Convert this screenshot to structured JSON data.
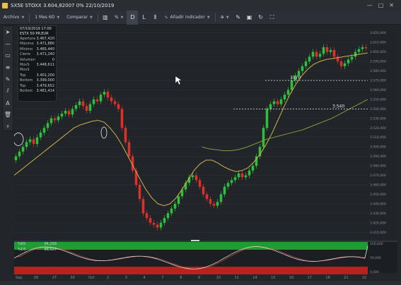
{
  "window": {
    "title": "SX5E STOXX 3.604,82007 0% 22/10/2019",
    "controls": [
      "—",
      "□",
      "✕"
    ]
  },
  "toolbar": {
    "archive_label": "Archivo",
    "period_label": "1 Mes 6D",
    "compare_label": "Comparar",
    "percent_label": "%",
    "d_label": "D",
    "l_label": "L",
    "indicator_label": "Añadir indicador"
  },
  "left_tools": [
    "cursor-icon",
    "crosshair-icon",
    "rectangle-icon",
    "fibonacci-icon",
    "pencil-icon",
    "channel-icon",
    "text-icon",
    "trash-icon",
    "magic-icon"
  ],
  "data_table": {
    "timestamp": "07/10/2019 17:00",
    "instrument": "ESTX 50 PR.EUR",
    "rows": [
      {
        "label": "Apertura",
        "value": "3.467,420"
      },
      {
        "label": "Máximo",
        "value": "3.471,880"
      },
      {
        "label": "Mínimo",
        "value": "3.465,440"
      },
      {
        "label": "Cierre",
        "value": "3.471,240"
      },
      {
        "label": "Volumen",
        "value": "0"
      },
      {
        "label": "MovS",
        "value": "3.448,611"
      },
      {
        "label": "MovS",
        "value": ""
      },
      {
        "label": "Top",
        "value": "3.401,200"
      },
      {
        "label": "Bottom",
        "value": "3.399,000"
      },
      {
        "label": "Top",
        "value": "3.479,652"
      },
      {
        "label": "Bottom",
        "value": "3.481,414"
      }
    ]
  },
  "indicator_legend": [
    {
      "label": "%KS",
      "value": "94,209"
    },
    {
      "label": "%DS",
      "value": "88,527"
    }
  ],
  "annotations": {
    "level_3570": "3570",
    "level_3540": "3.540"
  },
  "colors": {
    "up": "#2fbf3a",
    "down": "#e0302a",
    "ma_fast": "#d2b14a",
    "ma_slow": "#7f9b3e",
    "background": "#21252a"
  },
  "chart_data": {
    "type": "candlestick",
    "title": "SX5E STOXX",
    "y_ticks": [
      "3.620,000",
      "3.610,000",
      "3.600,000",
      "3.590,000",
      "3.580,000",
      "3.570,000",
      "3.560,000",
      "3.550,000",
      "3.540,000",
      "3.530,000",
      "3.520,000",
      "3.510,000",
      "3.500,000",
      "3.490,000",
      "3.480,000",
      "3.470,000",
      "3.460,000",
      "3.450,000",
      "3.440,000",
      "3.430,000",
      "3.420,000",
      "3.410,000"
    ],
    "ylim": [
      3405,
      3625
    ],
    "x_ticks": [
      "Sep",
      "26",
      "27",
      "30",
      "Oct",
      "2",
      "3",
      "4",
      "7",
      "8",
      "9",
      "10",
      "11",
      "14",
      "15",
      "16",
      "17",
      "18",
      "21",
      "22"
    ],
    "closes": [
      3490,
      3495,
      3500,
      3505,
      3508,
      3503,
      3510,
      3515,
      3520,
      3525,
      3530,
      3528,
      3532,
      3535,
      3538,
      3534,
      3540,
      3544,
      3548,
      3543,
      3538,
      3545,
      3550,
      3548,
      3555,
      3558,
      3552,
      3548,
      3545,
      3540,
      3520,
      3505,
      3490,
      3475,
      3460,
      3445,
      3430,
      3425,
      3420,
      3418,
      3415,
      3420,
      3425,
      3430,
      3435,
      3440,
      3448,
      3455,
      3462,
      3468,
      3470,
      3465,
      3458,
      3450,
      3445,
      3440,
      3438,
      3442,
      3450,
      3458,
      3462,
      3465,
      3468,
      3472,
      3468,
      3470,
      3475,
      3480,
      3490,
      3500,
      3520,
      3540,
      3545,
      3548,
      3545,
      3550,
      3555,
      3560,
      3570,
      3575,
      3580,
      3585,
      3590,
      3595,
      3600,
      3595,
      3598,
      3605,
      3600,
      3602,
      3595,
      3590,
      3585,
      3588,
      3592,
      3595,
      3600,
      3603,
      3605,
      3604
    ],
    "ma_fast": [
      3470,
      3475,
      3480,
      3485,
      3490,
      3495,
      3500,
      3505,
      3510,
      3515,
      3520,
      3523,
      3525,
      3527,
      3528,
      3526,
      3520,
      3512,
      3502,
      3490,
      3478,
      3466,
      3455,
      3446,
      3440,
      3438,
      3440,
      3446,
      3455,
      3465,
      3475,
      3482,
      3486,
      3486,
      3483,
      3479,
      3476,
      3474,
      3475,
      3478,
      3484,
      3492,
      3502,
      3514,
      3528,
      3542,
      3555,
      3566,
      3575,
      3582,
      3587,
      3590,
      3592,
      3593,
      3594,
      3595,
      3596,
      3597,
      3598,
      3599
    ],
    "ma_slow": [
      3500,
      3498,
      3497,
      3496,
      3496,
      3497,
      3499,
      3502,
      3505,
      3508,
      3510,
      3512,
      3514,
      3516,
      3518,
      3521,
      3524,
      3527,
      3530,
      3534,
      3538,
      3542,
      3546,
      3550
    ],
    "levels": [
      3570,
      3540
    ],
    "indicator": {
      "ks": 94.209,
      "ds": 88.527,
      "overbought": 80,
      "oversold": 20,
      "ylim": [
        0,
        100
      ]
    }
  }
}
